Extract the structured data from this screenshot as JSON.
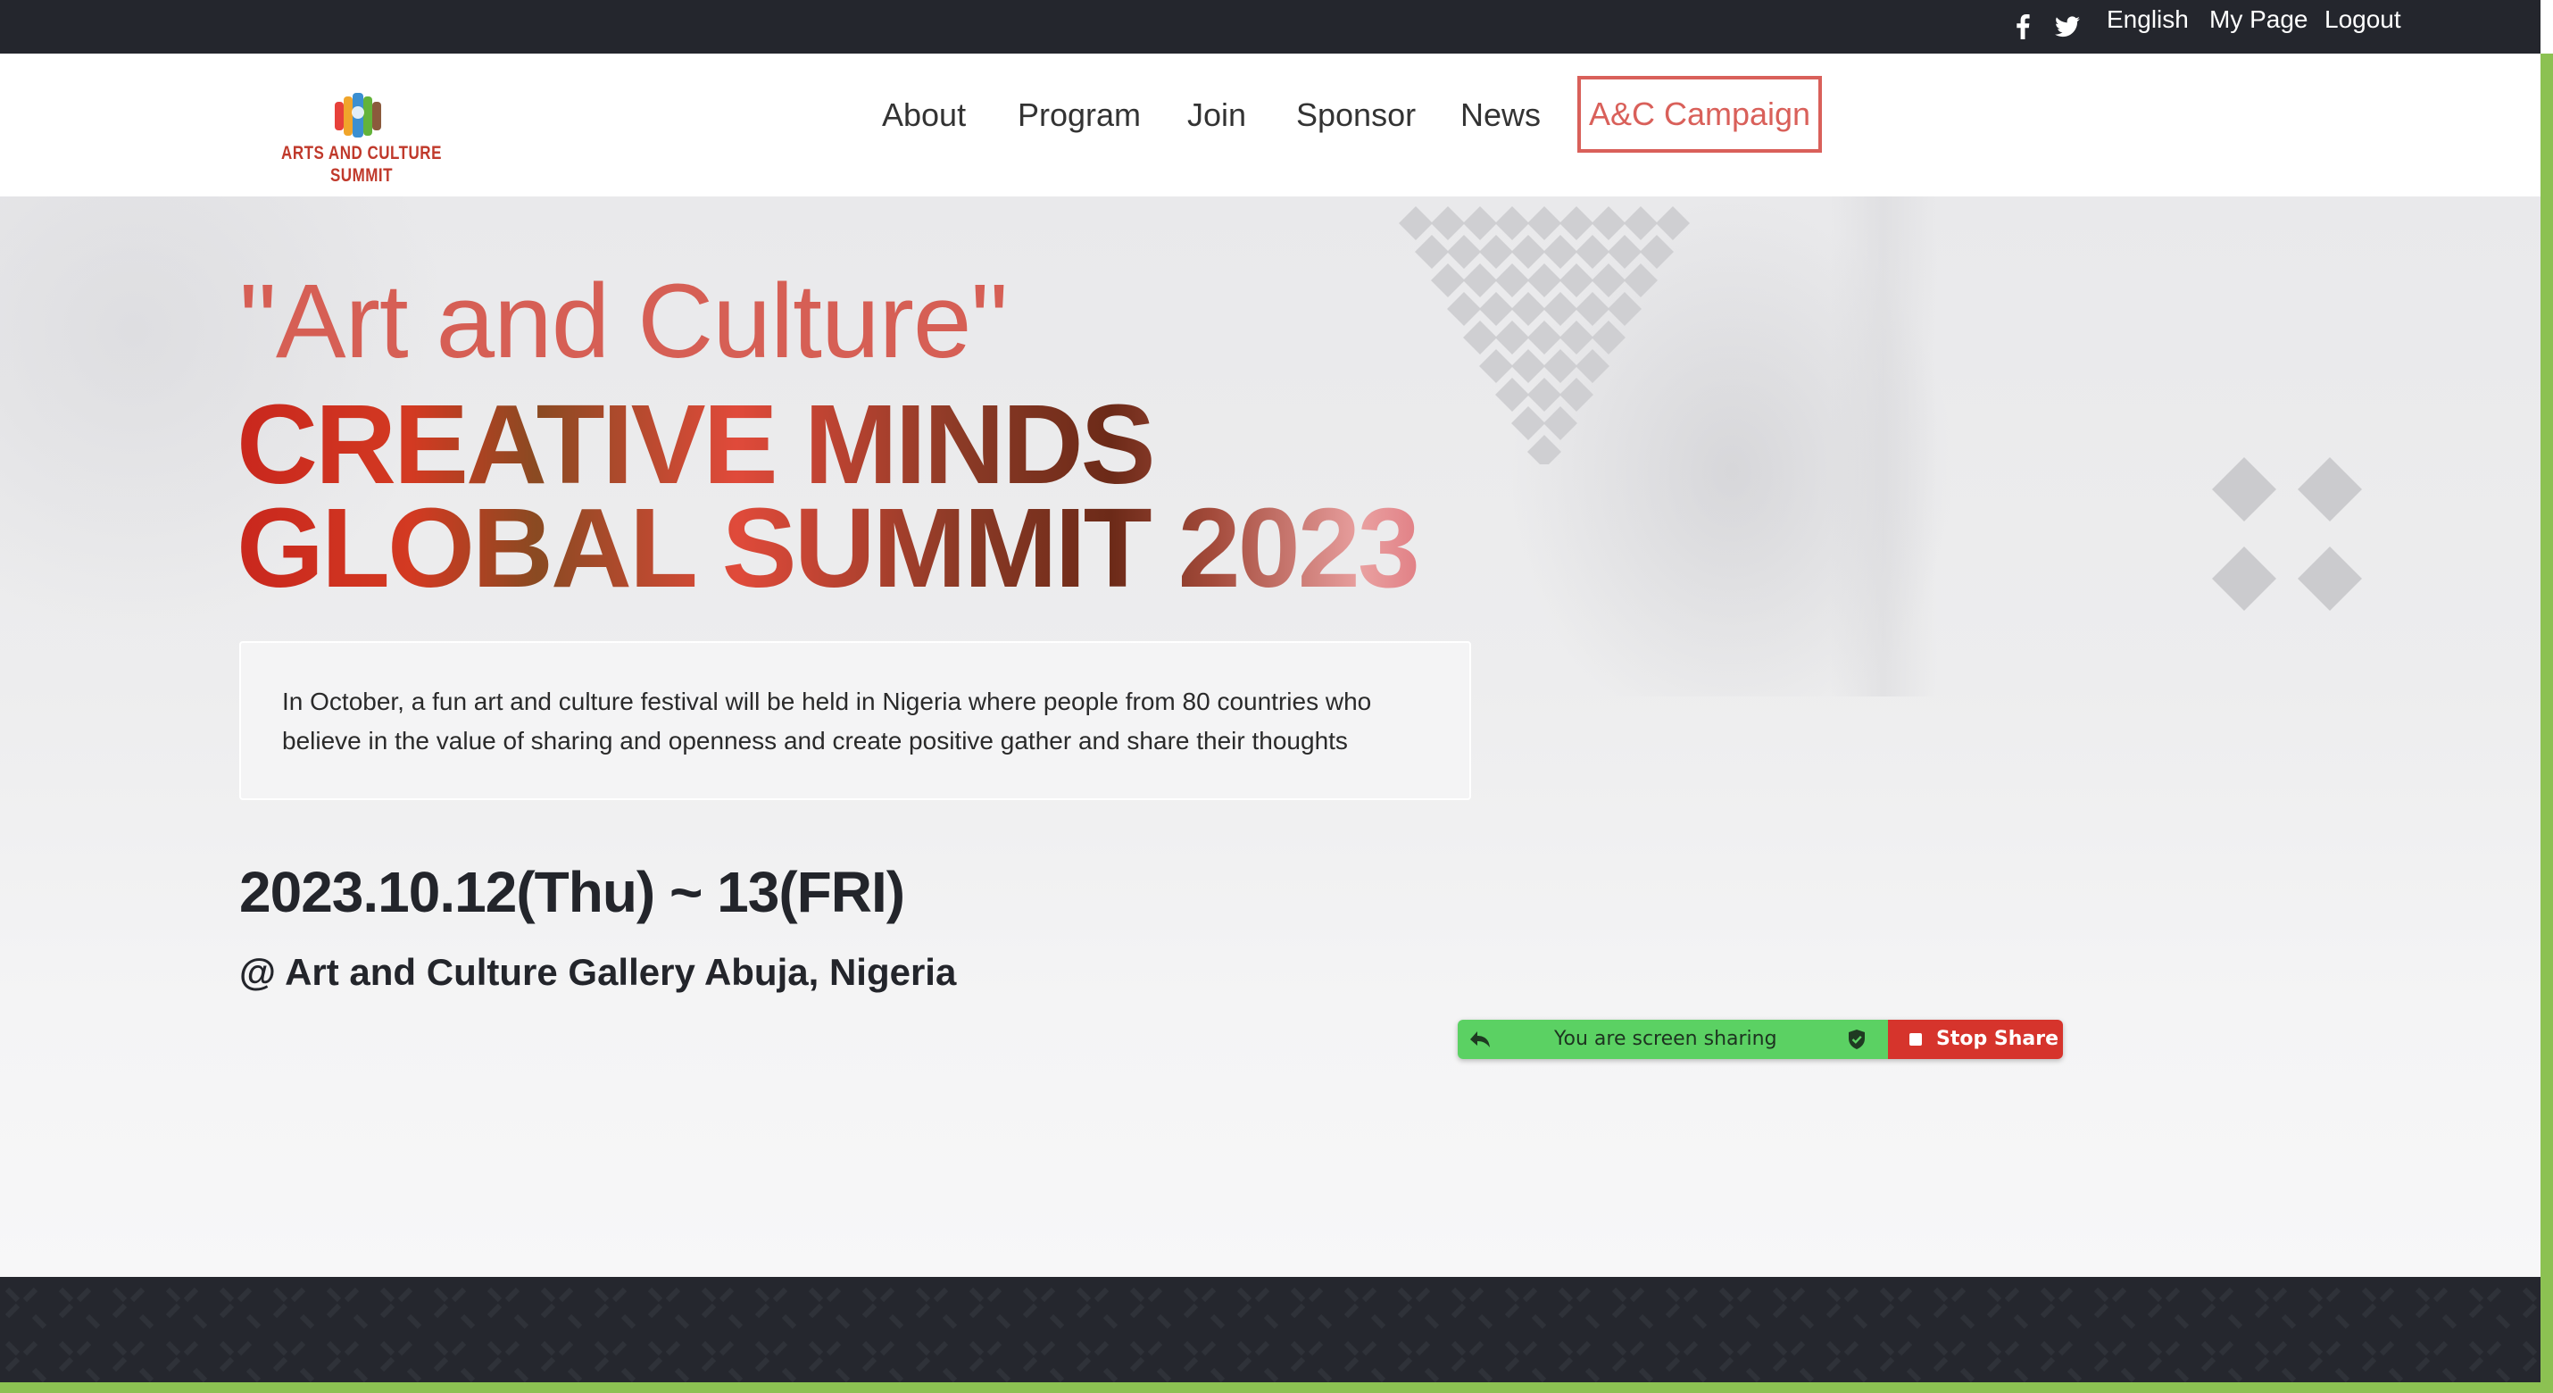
{
  "topbar": {
    "facebook_icon": "facebook-icon",
    "twitter_icon": "twitter-icon",
    "language": "English",
    "my_page": "My Page",
    "logout": "Logout"
  },
  "nav": {
    "logo_text": "ARTS AND CULTURE SUMMIT",
    "items": [
      "About",
      "Program",
      "Join",
      "Sponsor",
      "News"
    ],
    "campaign": "A&C Campaign"
  },
  "hero": {
    "subtitle": "\"Art and Culture\"",
    "title_line1": "CREATIVE MINDS",
    "title_line2": "GLOBAL SUMMIT 2023",
    "description": "In October, a fun art and culture festival will be held in Nigeria where people from 80 countries who believe in the value of sharing and openness and create positive gather and share their thoughts",
    "date": "2023.10.12(Thu) ~ 13(FRI)",
    "venue": "@ Art and Culture Gallery Abuja, Nigeria"
  },
  "screen_share": {
    "status": "You are screen sharing",
    "stop_label": "Stop Share"
  },
  "colors": {
    "accent": "#d65f55",
    "dark": "#24262d",
    "green_edge": "#8cc152",
    "share_green": "#5bd163",
    "share_red": "#d6342c"
  }
}
